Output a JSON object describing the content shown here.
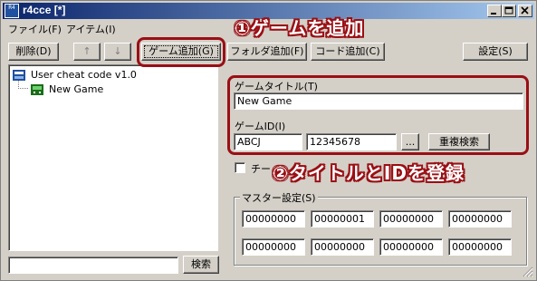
{
  "window": {
    "title": "r4cce [*]",
    "app_icon_text": "R4"
  },
  "menu": {
    "file": "ファイル(F)",
    "item": "アイテム(I)"
  },
  "toolbar": {
    "delete": "削除(D)",
    "up": "↑",
    "down": "↓",
    "add_game": "ゲーム追加(G)",
    "add_folder": "フォルダ追加(F)",
    "add_code": "コード追加(C)",
    "settings": "設定(S)"
  },
  "tree": {
    "root": "User cheat code v1.0",
    "child": "New Game"
  },
  "search": {
    "value": "",
    "button": "検索"
  },
  "game": {
    "title_label": "ゲームタイトル(T)",
    "title_value": "New Game",
    "id_label": "ゲームID(I)",
    "id_value1": "ABCJ",
    "id_value2": "12345678",
    "browse": "...",
    "dup_search": "重複検索"
  },
  "checkbox_label": "チー",
  "master": {
    "label": "マスター設定(S)",
    "row1": [
      "00000000",
      "00000001",
      "00000000",
      "00000000"
    ],
    "row2": [
      "00000000",
      "00000000",
      "00000000",
      "00000000"
    ]
  },
  "annotations": {
    "step1": "①ゲームを追加",
    "step2": "②タイトルとIDを登録"
  },
  "colors": {
    "titlebar_start": "#0a246a",
    "titlebar_end": "#a6caf0",
    "annotation_red": "#9a0f14",
    "face": "#d4d0c8"
  }
}
